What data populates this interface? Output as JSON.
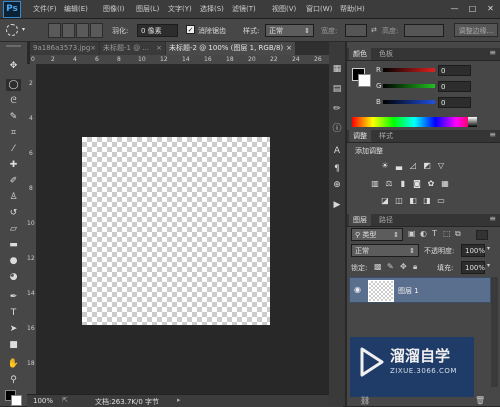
{
  "menubar": {
    "logo": "Ps",
    "items": [
      "文件(F)",
      "编辑(E)",
      "图像(I)",
      "图层(L)",
      "文字(Y)",
      "选择(S)",
      "滤镜(T)",
      "视图(V)",
      "窗口(W)",
      "帮助(H)"
    ],
    "window_controls": [
      "—",
      "□",
      "✕"
    ]
  },
  "options": {
    "feather_label": "羽化:",
    "feather_value": "0 像素",
    "antialias_label": "消除锯齿",
    "style_label": "样式:",
    "style_value": "正常",
    "width_label": "宽度:",
    "height_label": "高度:",
    "refine_edge": "调整边缘..."
  },
  "tabs": [
    {
      "label": "9a186a3573.jpg",
      "close": "×"
    },
    {
      "label": "未标题-1 @ ...",
      "close": "×"
    },
    {
      "label": "未标题-2 @ 100% (图层 1, RGB/8)",
      "close": "×"
    }
  ],
  "rulers": {
    "top": [
      "0",
      "2",
      "4",
      "6",
      "8",
      "10",
      "12",
      "14",
      "16",
      "18",
      "20",
      "22",
      "24",
      "26"
    ],
    "left": [
      "2",
      "4",
      "6",
      "8",
      "10",
      "12",
      "14",
      "16",
      "18"
    ]
  },
  "status": {
    "zoom": "100%",
    "doc_info": "文档:263.7K/0 字节"
  },
  "color_panel": {
    "tabs": [
      "颜色",
      "色板"
    ],
    "channels": [
      {
        "label": "R",
        "value": "0",
        "color": "#e02020"
      },
      {
        "label": "G",
        "value": "0",
        "color": "#20c020"
      },
      {
        "label": "B",
        "value": "0",
        "color": "#2050e0"
      }
    ]
  },
  "adjustments_panel": {
    "tabs": [
      "调整",
      "样式"
    ],
    "title": "添加调整"
  },
  "layers_panel": {
    "tabs": [
      "图层",
      "路径"
    ],
    "kind_label": "类型",
    "blend_mode": "正常",
    "opacity_label": "不透明度:",
    "opacity_value": "100%",
    "lock_label": "锁定:",
    "fill_label": "填充:",
    "fill_value": "100%",
    "layer_name": "图层 1"
  },
  "watermark": {
    "title": "溜溜自学",
    "url": "ZIXUE.3066.COM"
  }
}
